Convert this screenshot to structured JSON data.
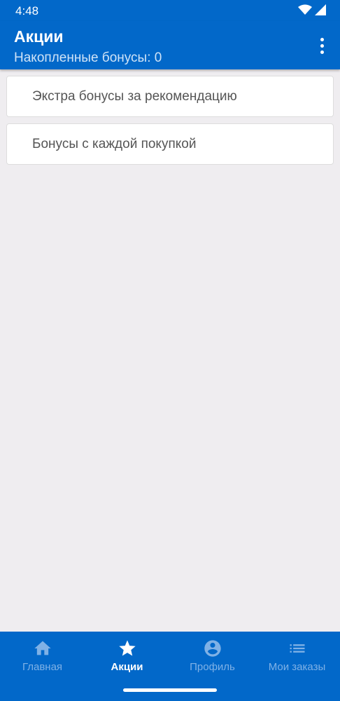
{
  "status_bar": {
    "time": "4:48",
    "icons": [
      "wifi-icon",
      "signal-icon"
    ]
  },
  "app_bar": {
    "title": "Акции",
    "subtitle": "Накопленные бонусы: 0",
    "menu_icon": "more-vert-icon"
  },
  "promotions": [
    {
      "label": "Экстра бонусы за рекомендацию"
    },
    {
      "label": "Бонусы с каждой покупкой"
    }
  ],
  "bottom_nav": {
    "items": [
      {
        "label": "Главная",
        "icon": "home-icon",
        "active": false
      },
      {
        "label": "Акции",
        "icon": "star-icon",
        "active": true
      },
      {
        "label": "Профиль",
        "icon": "account-circle-icon",
        "active": false
      },
      {
        "label": "Мои заказы",
        "icon": "list-icon",
        "active": false
      }
    ]
  },
  "colors": {
    "primary": "#0268c9",
    "background": "#efedf0",
    "nav_inactive": "#7fb1e6",
    "nav_active": "#ffffff"
  }
}
